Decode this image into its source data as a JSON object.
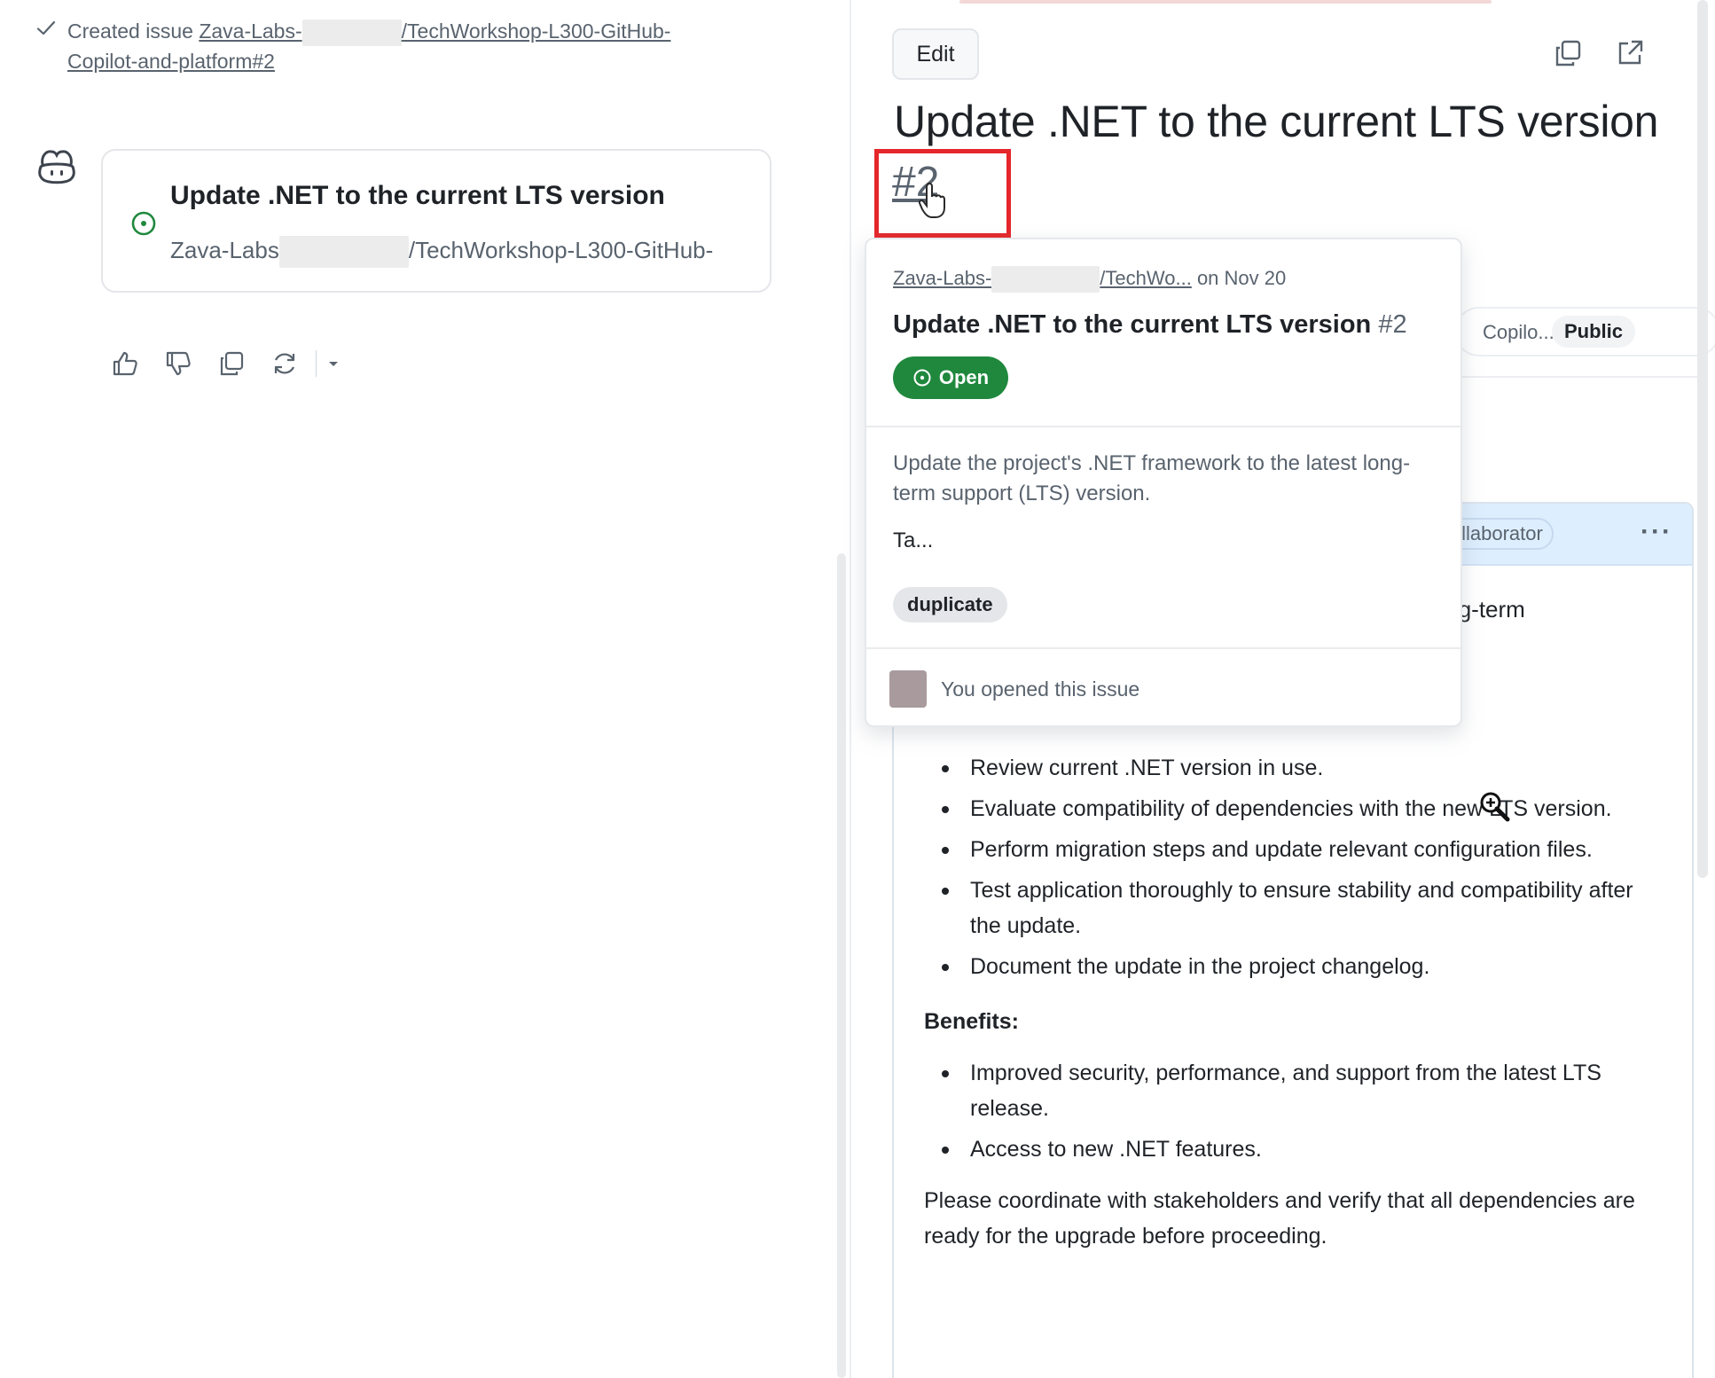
{
  "left": {
    "created_prefix": "Created issue",
    "created_org": "Zava-Labs-",
    "created_repo_line1": "/TechWorkshop-L300-GitHub-",
    "created_repo_line2": "Copilot-and-platform#2",
    "card": {
      "title": "Update .NET to the current LTS version",
      "org": "Zava-Labs",
      "repo": "/TechWorkshop-L300-GitHub-"
    },
    "reactions": [
      "thumbs-up-icon",
      "thumbs-down-icon",
      "copy-icon",
      "retry-icon",
      "caret-down-icon"
    ]
  },
  "right": {
    "edit_label": "Edit",
    "issue_title": "Update .NET to the current LTS version",
    "issue_number": "#2",
    "meta_copilot": "Copilo...",
    "meta_public": "Public",
    "collaborator": "Collaborator",
    "more": "···",
    "longterm_fragment": "long-term",
    "tasks": [
      "Review current .NET version in use.",
      "Evaluate compatibility of dependencies with the new LTS version.",
      "Perform migration steps and update relevant configuration files.",
      "Test application thoroughly to ensure stability and compatibility after the update.",
      "Document the update in the project changelog."
    ],
    "benefits_heading": "Benefits:",
    "benefits": [
      "Improved security, performance, and support from the latest LTS release.",
      "Access to new .NET features."
    ],
    "closing": "Please coordinate with stakeholders and verify that all dependencies are ready for the upgrade before proceeding."
  },
  "hovercard": {
    "org": "Zava-Labs-",
    "repo": "/TechWo...",
    "date": "on Nov 20",
    "title": "Update .NET to the current LTS version",
    "number": "#2",
    "state": "Open",
    "description": "Update the project's .NET framework to the latest long-term support (LTS) version.",
    "truncated": "Ta...",
    "label": "duplicate",
    "footer": "You opened this issue"
  },
  "colors": {
    "open_green": "#1f883d",
    "highlight_red": "#e5262a",
    "header_blue": "#ddeefe"
  }
}
